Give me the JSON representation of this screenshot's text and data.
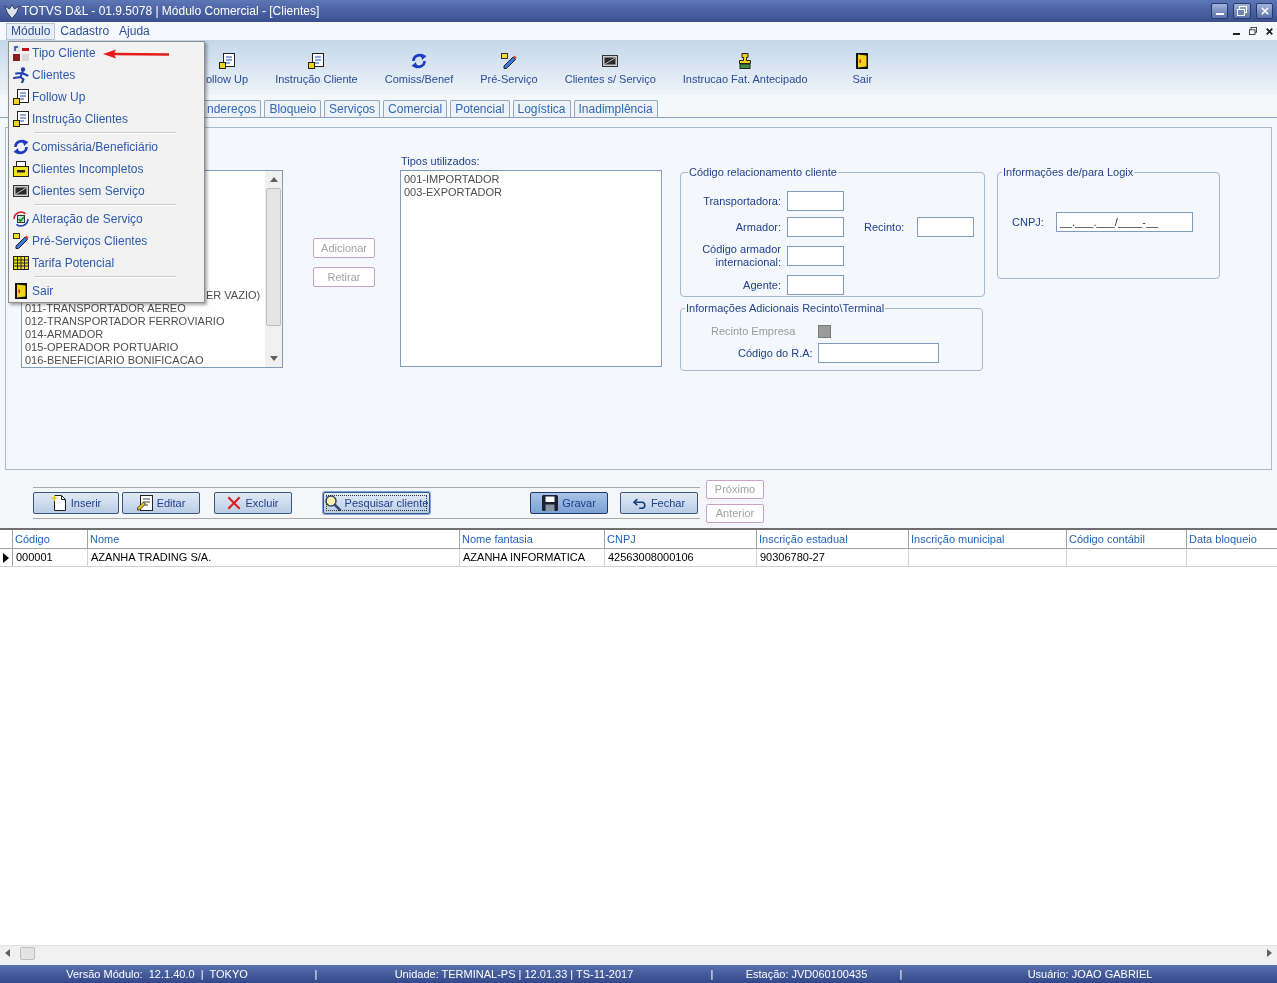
{
  "window": {
    "title": "TOTVS D&L - 01.9.5078 | Módulo Comercial - [Clientes]"
  },
  "menu_bar": [
    {
      "label": "Módulo",
      "selected": true
    },
    {
      "label": "Cadastro",
      "selected": false
    },
    {
      "label": "Ajuda",
      "selected": false
    }
  ],
  "menu": {
    "items": [
      {
        "kind": "item",
        "label": "Tipo Cliente"
      },
      {
        "kind": "item",
        "label": "Clientes"
      },
      {
        "kind": "item",
        "label": "Follow Up"
      },
      {
        "kind": "item",
        "label": "Instrução Clientes"
      },
      {
        "kind": "separator"
      },
      {
        "kind": "item",
        "label": "Comissária/Beneficiário"
      },
      {
        "kind": "item",
        "label": "Clientes Incompletos"
      },
      {
        "kind": "item",
        "label": "Clientes sem Serviço"
      },
      {
        "kind": "separator"
      },
      {
        "kind": "item",
        "label": "Alteração de Serviço"
      },
      {
        "kind": "item",
        "label": "Pré-Serviços Clientes"
      },
      {
        "kind": "item",
        "label": "Tarifa Potencial"
      },
      {
        "kind": "separator"
      },
      {
        "kind": "item",
        "label": "Sair"
      }
    ]
  },
  "toolbar": [
    {
      "label": "ollow Up"
    },
    {
      "label": "Instrução Cliente"
    },
    {
      "label": "Comiss/Benef"
    },
    {
      "label": "Pré-Serviço"
    },
    {
      "label": "Clientes s/ Serviço"
    },
    {
      "label": "Instrucao Fat. Antecipado"
    },
    {
      "label": "Sair"
    }
  ],
  "tabs": [
    {
      "label": "ndereços",
      "selected": false
    },
    {
      "label": "Bloqueio",
      "selected": false
    },
    {
      "label": "Serviços",
      "selected": false
    },
    {
      "label": "Comercial",
      "selected": false
    },
    {
      "label": "Potencial",
      "selected": false
    },
    {
      "label": "Logística",
      "selected": false
    },
    {
      "label": "Inadimplência",
      "selected": false
    }
  ],
  "available_list": {
    "items": [
      "ER VAZIO)",
      "011-TRANSPORTADOR AEREO",
      "012-TRANSPORTADOR FERROVIARIO",
      "014-ARMADOR",
      "015-OPERADOR PORTUARIO",
      "016-BENEFICIARIO BONIFICACAO"
    ]
  },
  "transfer_buttons": [
    {
      "label": "Adicionar",
      "disabled": true
    },
    {
      "label": "Retirar",
      "disabled": true
    }
  ],
  "used_list": {
    "label": "Tipos utilizados:",
    "items": [
      "001-IMPORTADOR",
      "003-EXPORTADOR"
    ]
  },
  "relationship_group": {
    "title": "Código relacionamento cliente",
    "rows": [
      {
        "fields": [
          {
            "label": "Transportadora:"
          }
        ]
      },
      {
        "fields": [
          {
            "label": "Armador:"
          },
          {
            "label": "Recinto:"
          }
        ]
      },
      {
        "fields": [
          {
            "label": "Código armador internacional:"
          }
        ]
      },
      {
        "fields": [
          {
            "label": "Agente:"
          }
        ]
      }
    ]
  },
  "terminal_group": {
    "title": "Informações Adicionais Recinto\\Terminal",
    "checkbox": {
      "label": "Recinto Empresa",
      "checked": false,
      "disabled": true
    },
    "field": {
      "label": "Código do R.A:"
    }
  },
  "logix_group": {
    "title": "Informações de/para Logix",
    "field": {
      "label": "CNPJ:",
      "value": "__.___.___/____-__"
    }
  },
  "action_buttons": [
    {
      "label": "Inserir",
      "focused": false,
      "default": false
    },
    {
      "label": "Editar",
      "focused": false,
      "default": false
    },
    {
      "label": "Excluir",
      "focused": false,
      "default": false
    },
    {
      "label": "Pesquisar cliente",
      "focused": true,
      "default": false
    },
    {
      "label": "Gravar",
      "focused": false,
      "default": true
    },
    {
      "label": "Fechar",
      "focused": false,
      "default": false
    }
  ],
  "nav_buttons": [
    {
      "label": "Próximo",
      "disabled": true
    },
    {
      "label": "Anterior",
      "disabled": true
    }
  ],
  "table": {
    "columns": [
      "Código",
      "Nome",
      "Nome fantasia",
      "CNPJ",
      "Inscrição estadual",
      "Inscrição municipal",
      "Código contábil",
      "Data bloqueio"
    ],
    "rows": [
      {
        "selected": true,
        "cells": [
          "000001",
          "AZANHA TRADING S/A.",
          "AZANHA INFORMATICA",
          "42563008000106",
          "90306780-27"
        ]
      }
    ]
  },
  "status_bar": [
    {
      "kind": "text",
      "text": "Versão Módulo:  12.1.40.0  |  TOKYO"
    },
    {
      "kind": "separator",
      "text": "|"
    },
    {
      "kind": "text",
      "text": "Unidade: TERMINAL-PS | 12.01.33 | TS-11-2017"
    },
    {
      "kind": "separator",
      "text": "|"
    },
    {
      "kind": "text",
      "text": "Estação: JVD060100435"
    },
    {
      "kind": "separator",
      "text": "|"
    },
    {
      "kind": "text",
      "text": "Usuário: JOAO GABRIEL"
    }
  ]
}
